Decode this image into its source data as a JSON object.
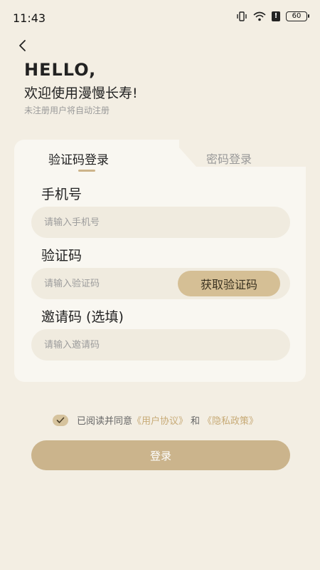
{
  "status_bar": {
    "time": "11:43",
    "battery": "60",
    "icons": [
      "vibrate-icon",
      "wifi-icon",
      "alert-icon",
      "battery-icon"
    ]
  },
  "header": {
    "back_icon": "chevron-left-icon",
    "hello": "HELLO,",
    "welcome": "欢迎使用漫慢长寿!",
    "hint": "未注册用户将自动注册"
  },
  "tabs": {
    "sms_login": "验证码登录",
    "password_login": "密码登录",
    "active": "sms_login"
  },
  "form": {
    "phone_label": "手机号",
    "phone_placeholder": "请输入手机号",
    "code_label": "验证码",
    "code_placeholder": "请输入验证码",
    "get_code_button": "获取验证码",
    "invite_label": "邀请码 (选填)",
    "invite_placeholder": "请输入邀请码"
  },
  "agreement": {
    "checked": true,
    "prefix": "已阅读并同意",
    "user_agreement": "《用户协议》",
    "and": "和",
    "privacy_policy": "《隐私政策》"
  },
  "login_button": "登录",
  "colors": {
    "background": "#f3eee3",
    "card": "#f9f7f1",
    "accent": "#cbb48c",
    "link": "#c7aa76"
  }
}
